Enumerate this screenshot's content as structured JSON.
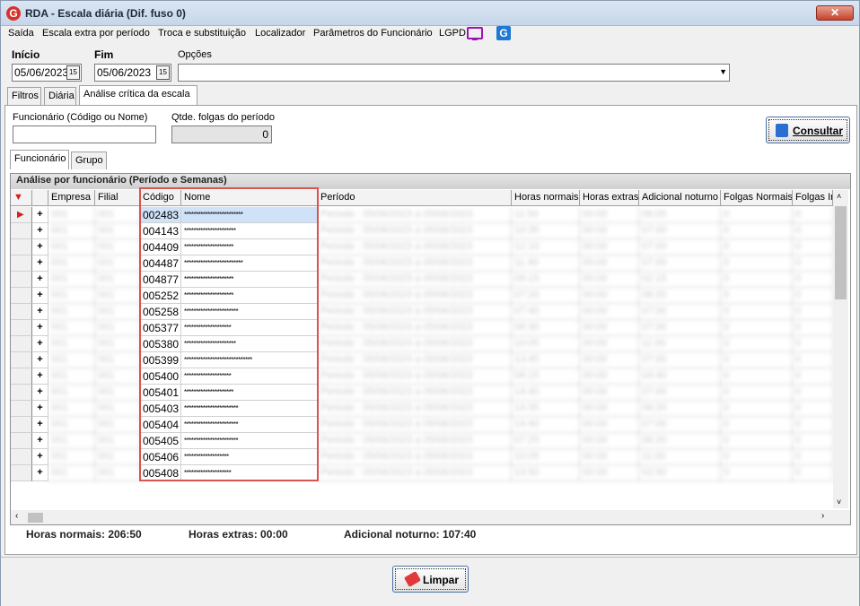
{
  "window": {
    "title": "RDA - Escala diária (Dif. fuso 0)",
    "app_icon": "G",
    "close_label": "✕"
  },
  "menu": [
    "Saída",
    "Escala extra por período",
    "Troca e substituição",
    "Localizador",
    "Parâmetros do Funcionário",
    "LGPD"
  ],
  "menu_icons": [
    "monitor-icon",
    "g-app-icon"
  ],
  "form": {
    "inicio_label": "Início",
    "inicio_value": "05/06/2023",
    "fim_label": "Fim",
    "fim_value": "05/06/2023",
    "opcoes_label": "Opções",
    "opcoes_value": "",
    "calendar_glyph": "15"
  },
  "tabs": [
    "Filtros",
    "Diária",
    "Análise crítica da escala"
  ],
  "active_tab": "Análise crítica da escala",
  "analysis": {
    "funcionario_label": "Funcionário (Código ou Nome)",
    "funcionario_value": "",
    "folgas_label": "Qtde. folgas do período",
    "folgas_value": "0",
    "consultar_label": "Consultar"
  },
  "subtabs": [
    "Funcionário",
    "Grupo"
  ],
  "grid": {
    "caption": "Análise por funcionário (Período e Semanas)",
    "columns": [
      "Empresa",
      "Filial",
      "Código",
      "Nome",
      "Período",
      "Horas normais",
      "Horas extras",
      "Adicional noturno",
      "Folgas Normais",
      "Folgas Ir"
    ],
    "rows": [
      {
        "codigo": "002483",
        "nome": "*************************",
        "empresa": "001",
        "filial": "001",
        "periodo": "Periodo : 05/06/2023 a 05/06/2023",
        "hn": "11:50",
        "he": "00:00",
        "an": "06:05",
        "fn": "0",
        "fi": "0"
      },
      {
        "codigo": "004143",
        "nome": "**********************",
        "empresa": "001",
        "filial": "001",
        "periodo": "Periodo : 05/06/2023 a 05/06/2023",
        "hn": "10:35",
        "he": "00:00",
        "an": "07:00",
        "fn": "0",
        "fi": "0"
      },
      {
        "codigo": "004409",
        "nome": "*********************",
        "empresa": "001",
        "filial": "001",
        "periodo": "Periodo : 05/06/2023 a 05/06/2023",
        "hn": "12:10",
        "he": "00:00",
        "an": "07:00",
        "fn": "0",
        "fi": "0"
      },
      {
        "codigo": "004487",
        "nome": "*************************",
        "empresa": "001",
        "filial": "001",
        "periodo": "Periodo : 05/06/2023 a 05/06/2023",
        "hn": "11:40",
        "he": "00:00",
        "an": "07:00",
        "fn": "0",
        "fi": "0"
      },
      {
        "codigo": "004877",
        "nome": "*********************",
        "empresa": "001",
        "filial": "001",
        "periodo": "Periodo : 05/06/2023 a 05/06/2023",
        "hn": "09:15",
        "he": "00:00",
        "an": "02:15",
        "fn": "0",
        "fi": "0"
      },
      {
        "codigo": "005252",
        "nome": "*********************",
        "empresa": "001",
        "filial": "001",
        "periodo": "Periodo : 05/06/2023 a 05/06/2023",
        "hn": "07:20",
        "he": "00:00",
        "an": "06:20",
        "fn": "0",
        "fi": "0"
      },
      {
        "codigo": "005258",
        "nome": "***********************",
        "empresa": "001",
        "filial": "001",
        "periodo": "Periodo : 05/06/2023 a 05/06/2023",
        "hn": "07:40",
        "he": "00:00",
        "an": "07:00",
        "fn": "0",
        "fi": "0"
      },
      {
        "codigo": "005377",
        "nome": "********************",
        "empresa": "001",
        "filial": "001",
        "periodo": "Periodo : 05/06/2023 a 05/06/2023",
        "hn": "06:30",
        "he": "00:00",
        "an": "07:00",
        "fn": "0",
        "fi": "0"
      },
      {
        "codigo": "005380",
        "nome": "**********************",
        "empresa": "001",
        "filial": "001",
        "periodo": "Periodo : 05/06/2023 a 05/06/2023",
        "hn": "10:05",
        "he": "00:00",
        "an": "11:00",
        "fn": "0",
        "fi": "0"
      },
      {
        "codigo": "005399",
        "nome": "*****************************",
        "empresa": "001",
        "filial": "001",
        "periodo": "Periodo : 05/06/2023 a 05/06/2023",
        "hn": "13:45",
        "he": "00:00",
        "an": "07:00",
        "fn": "0",
        "fi": "0"
      },
      {
        "codigo": "005400",
        "nome": "********************",
        "empresa": "001",
        "filial": "001",
        "periodo": "Periodo : 05/06/2023 a 05/06/2023",
        "hn": "09:15",
        "he": "00:00",
        "an": "03:40",
        "fn": "0",
        "fi": "0"
      },
      {
        "codigo": "005401",
        "nome": "*********************",
        "empresa": "001",
        "filial": "001",
        "periodo": "Periodo : 05/06/2023 a 05/06/2023",
        "hn": "14:40",
        "he": "00:00",
        "an": "07:00",
        "fn": "0",
        "fi": "0"
      },
      {
        "codigo": "005403",
        "nome": "***********************",
        "empresa": "001",
        "filial": "001",
        "periodo": "Periodo : 05/06/2023 a 05/06/2023",
        "hn": "14:35",
        "he": "00:00",
        "an": "06:20",
        "fn": "0",
        "fi": "0"
      },
      {
        "codigo": "005404",
        "nome": "***********************",
        "empresa": "001",
        "filial": "001",
        "periodo": "Periodo : 05/06/2023 a 05/06/2023",
        "hn": "14:40",
        "he": "00:00",
        "an": "07:00",
        "fn": "0",
        "fi": "0"
      },
      {
        "codigo": "005405",
        "nome": "***********************",
        "empresa": "001",
        "filial": "001",
        "periodo": "Periodo : 05/06/2023 a 05/06/2023",
        "hn": "07:25",
        "he": "00:00",
        "an": "06:20",
        "fn": "0",
        "fi": "0"
      },
      {
        "codigo": "005406",
        "nome": "*******************",
        "empresa": "001",
        "filial": "001",
        "periodo": "Periodo : 05/06/2023 a 05/06/2023",
        "hn": "10:05",
        "he": "00:00",
        "an": "11:00",
        "fn": "0",
        "fi": "0"
      },
      {
        "codigo": "005408",
        "nome": "********************",
        "empresa": "001",
        "filial": "001",
        "periodo": "Periodo : 05/06/2023 a 05/06/2023",
        "hn": "13:50",
        "he": "00:00",
        "an": "02:50",
        "fn": "0",
        "fi": "0"
      }
    ]
  },
  "totals": {
    "horas_normais": "Horas normais: 206:50",
    "horas_extras": "Horas extras: 00:00",
    "adicional_noturno": "Adicional noturno: 107:40"
  },
  "footer": {
    "limpar_label": "Limpar"
  }
}
